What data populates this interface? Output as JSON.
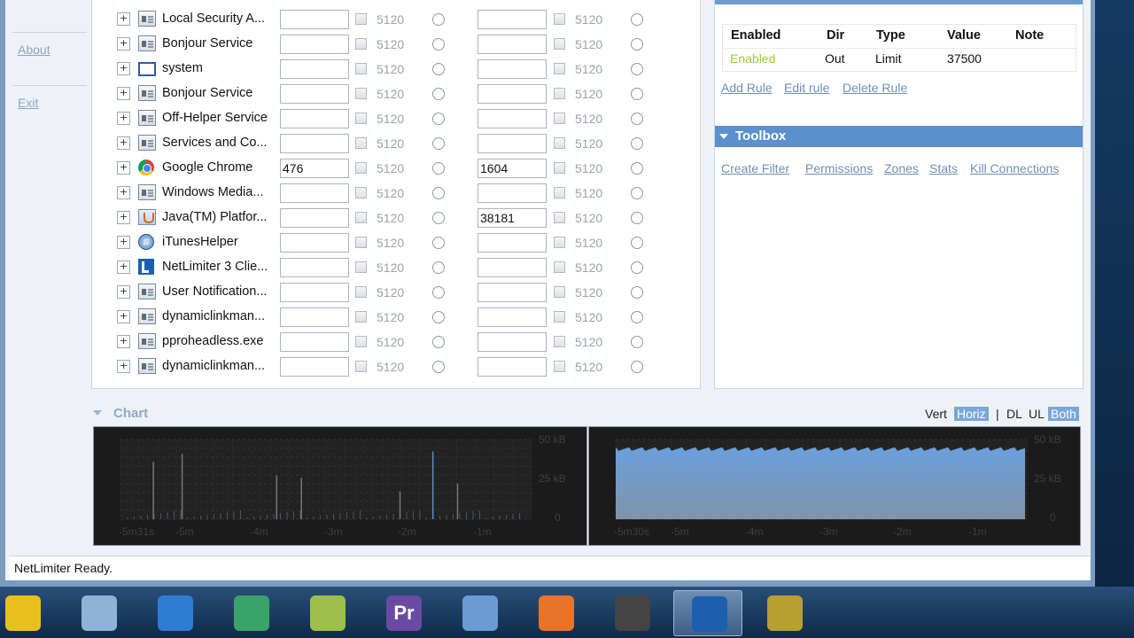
{
  "sidebar": {
    "links": [
      {
        "label": "About"
      },
      {
        "label": "Exit"
      }
    ]
  },
  "app_rows": [
    {
      "name": "Local Security A...",
      "icon": "generic-app-icon",
      "dl_value": "",
      "dl_limit": "5120",
      "ul_value": "",
      "ul_limit": "5120"
    },
    {
      "name": "Bonjour Service",
      "icon": "generic-app-icon",
      "dl_value": "",
      "dl_limit": "5120",
      "ul_value": "",
      "ul_limit": "5120"
    },
    {
      "name": "system",
      "icon": "window-icon",
      "dl_value": "",
      "dl_limit": "5120",
      "ul_value": "",
      "ul_limit": "5120"
    },
    {
      "name": "Bonjour Service",
      "icon": "generic-app-icon",
      "dl_value": "",
      "dl_limit": "5120",
      "ul_value": "",
      "ul_limit": "5120"
    },
    {
      "name": "Off-Helper Service",
      "icon": "generic-app-icon",
      "dl_value": "",
      "dl_limit": "5120",
      "ul_value": "",
      "ul_limit": "5120"
    },
    {
      "name": "Services and Co...",
      "icon": "generic-app-icon",
      "dl_value": "",
      "dl_limit": "5120",
      "ul_value": "",
      "ul_limit": "5120"
    },
    {
      "name": "Google Chrome",
      "icon": "chrome-icon",
      "dl_value": "476",
      "dl_limit": "5120",
      "ul_value": "1604",
      "ul_limit": "5120"
    },
    {
      "name": "Windows Media...",
      "icon": "generic-app-icon",
      "dl_value": "",
      "dl_limit": "5120",
      "ul_value": "",
      "ul_limit": "5120"
    },
    {
      "name": "Java(TM) Platfor...",
      "icon": "java-icon",
      "dl_value": "",
      "dl_limit": "5120",
      "ul_value": "38181",
      "ul_limit": "5120"
    },
    {
      "name": "iTunesHelper",
      "icon": "itunes-icon",
      "dl_value": "",
      "dl_limit": "5120",
      "ul_value": "",
      "ul_limit": "5120"
    },
    {
      "name": "NetLimiter 3 Clie...",
      "icon": "netlimiter-icon",
      "dl_value": "",
      "dl_limit": "5120",
      "ul_value": "",
      "ul_limit": "5120"
    },
    {
      "name": "User Notification...",
      "icon": "generic-app-icon",
      "dl_value": "",
      "dl_limit": "5120",
      "ul_value": "",
      "ul_limit": "5120"
    },
    {
      "name": "dynamiclinkman...",
      "icon": "generic-app-icon",
      "dl_value": "",
      "dl_limit": "5120",
      "ul_value": "",
      "ul_limit": "5120"
    },
    {
      "name": "pproheadless.exe",
      "icon": "generic-app-icon",
      "dl_value": "",
      "dl_limit": "5120",
      "ul_value": "",
      "ul_limit": "5120"
    },
    {
      "name": "dynamiclinkman...",
      "icon": "generic-app-icon",
      "dl_value": "",
      "dl_limit": "5120",
      "ul_value": "",
      "ul_limit": "5120"
    }
  ],
  "rules": {
    "headers": [
      "Enabled",
      "Dir",
      "Type",
      "Value",
      "Note"
    ],
    "row": {
      "enabled": "Enabled",
      "dir": "Out",
      "type": "Limit",
      "value": "37500",
      "note": ""
    },
    "enabled_color": "#9acd32",
    "actions": [
      "Add Rule",
      "Edit rule",
      "Delete Rule"
    ]
  },
  "toolbox": {
    "title": "Toolbox",
    "links": [
      "Create Filter",
      "Permissions",
      "Zones",
      "Stats",
      "Kill Connections"
    ]
  },
  "chart": {
    "title": "Chart",
    "options": [
      "Vert",
      "Horiz",
      "|",
      "DL",
      "UL",
      "Both"
    ],
    "selected": [
      "Horiz",
      "Both"
    ]
  },
  "chart_data": [
    {
      "type": "bar",
      "title": "",
      "x": [
        "-5m31s",
        "-5m",
        "-4m",
        "-3m",
        "-2m",
        "-1m"
      ],
      "y_ticks": [
        "50 kB",
        "25 kB",
        "0"
      ],
      "ylim": [
        0,
        50
      ],
      "spikes": [
        {
          "t": 0.08,
          "v": 0.72
        },
        {
          "t": 0.15,
          "v": 0.82
        },
        {
          "t": 0.38,
          "v": 0.55
        },
        {
          "t": 0.44,
          "v": 0.52
        },
        {
          "t": 0.68,
          "v": 0.35
        },
        {
          "t": 0.76,
          "v": 0.85
        },
        {
          "t": 0.82,
          "v": 0.45
        }
      ]
    },
    {
      "type": "area",
      "title": "",
      "x": [
        "-5m30s",
        "-5m",
        "-4m",
        "-3m",
        "-2m",
        "-1m"
      ],
      "y_ticks": [
        "50 kB",
        "25 kB",
        "0"
      ],
      "ylim": [
        0,
        50
      ],
      "level": 0.88
    }
  ],
  "status": {
    "text": "NetLimiter Ready."
  },
  "taskbar": {
    "items": [
      {
        "name": "bird-app-icon",
        "color": "#e9c01b"
      },
      {
        "name": "network-icon",
        "color": "#8fb3d8"
      },
      {
        "name": "itunes-icon",
        "color": "#2f7cd4"
      },
      {
        "name": "earth-app-icon",
        "color": "#3aa36a"
      },
      {
        "name": "notes-icon",
        "color": "#9cc04a"
      },
      {
        "name": "premiere-icon",
        "color": "#6a4aa3",
        "text": "Pr"
      },
      {
        "name": "virtualbox-icon",
        "color": "#6a9bd1"
      },
      {
        "name": "office-icon",
        "color": "#e8742a"
      },
      {
        "name": "media-encoder-icon",
        "color": "#444444"
      },
      {
        "name": "netlimiter-icon",
        "color": "#1c5fae"
      },
      {
        "name": "camera-icon",
        "color": "#b8a030"
      }
    ]
  }
}
